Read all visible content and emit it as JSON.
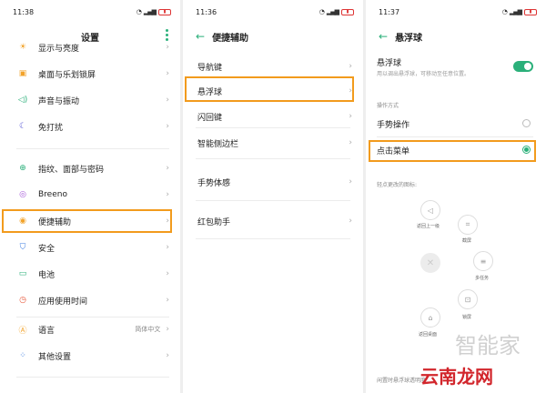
{
  "accent": "#2bb07a",
  "highlight_color": "#f29b1d",
  "screen1": {
    "time": "11:38",
    "title": "设置",
    "items": [
      {
        "label": "显示与亮度",
        "icon": "sun-icon"
      },
      {
        "label": "桌面与乐划锁屏",
        "icon": "desktop-icon"
      },
      {
        "label": "声音与振动",
        "icon": "speaker-icon"
      },
      {
        "label": "免打扰",
        "icon": "moon-icon"
      },
      {
        "label": "指纹、面部与密码",
        "icon": "fingerprint-icon"
      },
      {
        "label": "Breeno",
        "icon": "breeno-icon"
      },
      {
        "label": "便捷辅助",
        "icon": "assist-icon"
      },
      {
        "label": "安全",
        "icon": "shield-icon"
      },
      {
        "label": "电池",
        "icon": "battery-icon"
      },
      {
        "label": "应用使用时间",
        "icon": "clock-icon"
      },
      {
        "label": "语言",
        "value": "简体中文",
        "icon": "language-icon"
      },
      {
        "label": "其他设置",
        "icon": "more-settings-icon"
      }
    ]
  },
  "screen2": {
    "time": "11:36",
    "title": "便捷辅助",
    "items": [
      {
        "label": "导航键"
      },
      {
        "label": "悬浮球"
      },
      {
        "label": "闪回键"
      },
      {
        "label": "智能侧边栏"
      },
      {
        "label": "手势体感"
      },
      {
        "label": "红包助手"
      }
    ]
  },
  "screen3": {
    "time": "11:37",
    "title": "悬浮球",
    "toggle_label": "悬浮球",
    "toggle_desc": "用以调出悬浮球，可移动至任意位置。",
    "mode_heading": "操作方式",
    "mode_gesture": "手势操作",
    "mode_tap": "点击菜单",
    "edit_heading": "轻点更改的图标:",
    "buttons": {
      "back": "返回上一级",
      "screenshot": "截屏",
      "multitask": "多任务",
      "home": "返回桌面",
      "lock": "锁屏"
    },
    "footer": "闲置时悬浮球透明度"
  },
  "watermark": {
    "gray": "智能家",
    "red": "云南龙网"
  }
}
